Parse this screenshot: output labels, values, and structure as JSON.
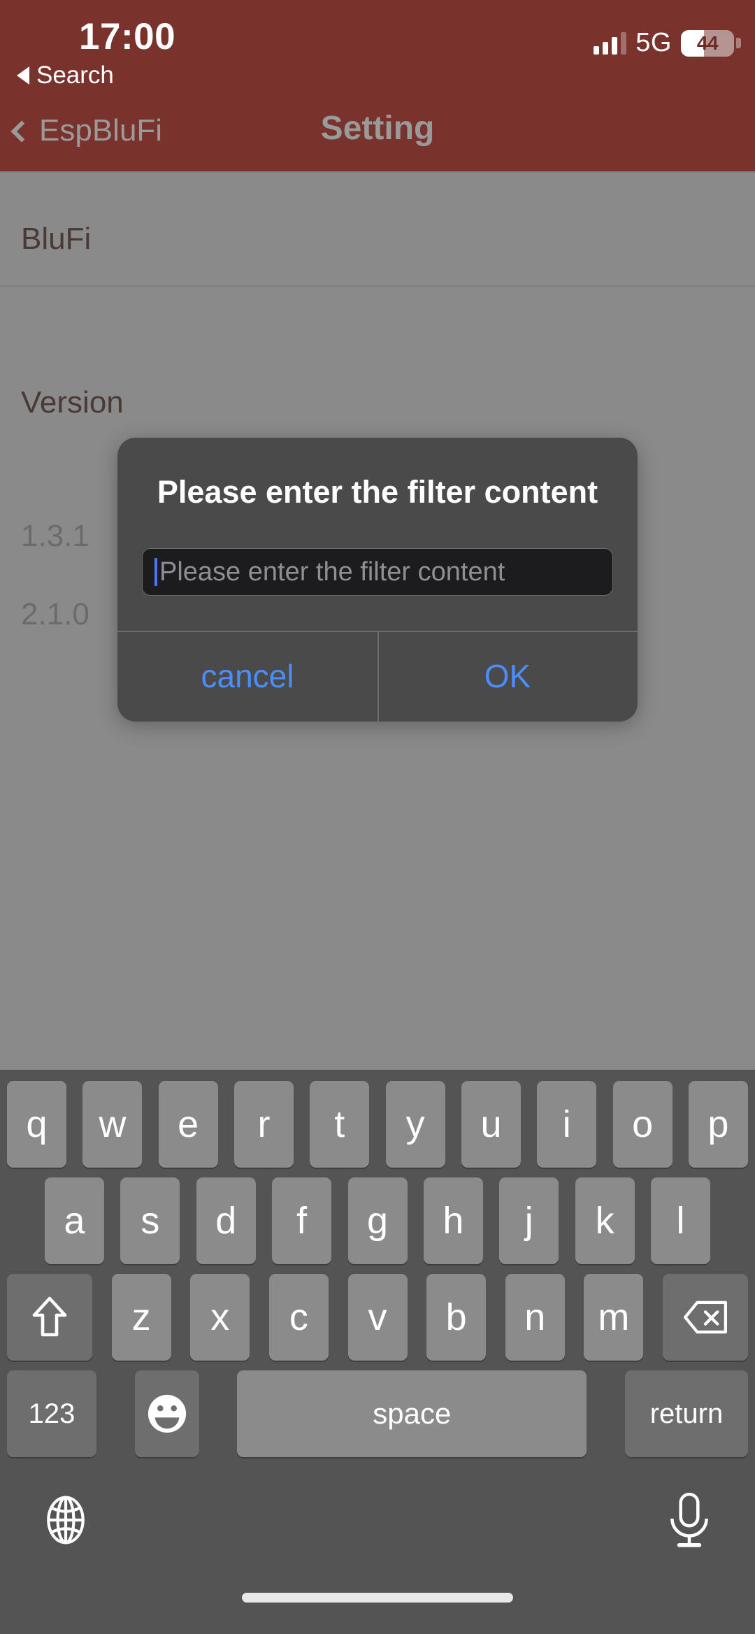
{
  "status_bar": {
    "time": "17:00",
    "back_app_label": "Search",
    "back_arrow_icon": "triangle-left-icon",
    "signal_icon": "cellular-signal-icon",
    "signal_bars_filled": 3,
    "signal_bars_total": 4,
    "network": "5G",
    "battery_percent": "44",
    "battery_level": 44,
    "battery_icon": "battery-icon"
  },
  "nav_bar": {
    "back_icon": "chevron-left-icon",
    "back_label": "EspBluFi",
    "title": "Setting"
  },
  "content": {
    "rows": [
      {
        "label": "BluFi",
        "value": ""
      },
      {
        "label": "Version",
        "value": ""
      }
    ],
    "versions": [
      "1.3.1",
      "2.1.0"
    ]
  },
  "dialog": {
    "title": "Please enter the filter content",
    "input_value": "",
    "input_placeholder": "Please enter the filter content",
    "cancel_label": "cancel",
    "ok_label": "OK",
    "accent_color": "#4b8dfb",
    "background_color": "#4a4a4a",
    "input_background_color": "#1c1c1e"
  },
  "keyboard": {
    "row1": [
      "q",
      "w",
      "e",
      "r",
      "t",
      "y",
      "u",
      "i",
      "o",
      "p"
    ],
    "row2": [
      "a",
      "s",
      "d",
      "f",
      "g",
      "h",
      "j",
      "k",
      "l"
    ],
    "row3_letters": [
      "z",
      "x",
      "c",
      "v",
      "b",
      "n",
      "m"
    ],
    "shift_icon": "shift-arrow-up-icon",
    "backspace_icon": "backspace-delete-icon",
    "numbers_label": "123",
    "emoji_icon": "emoji-smiley-icon",
    "space_label": "space",
    "return_label": "return",
    "globe_icon": "globe-language-icon",
    "microphone_icon": "microphone-dictation-icon",
    "key_color": "#8b8b8b",
    "modifier_key_color": "#6e6e6e",
    "background_color": "#545454"
  },
  "theme": {
    "status_bar_color": "#79322c",
    "dimmed_page_color": "#8a8a8a"
  }
}
